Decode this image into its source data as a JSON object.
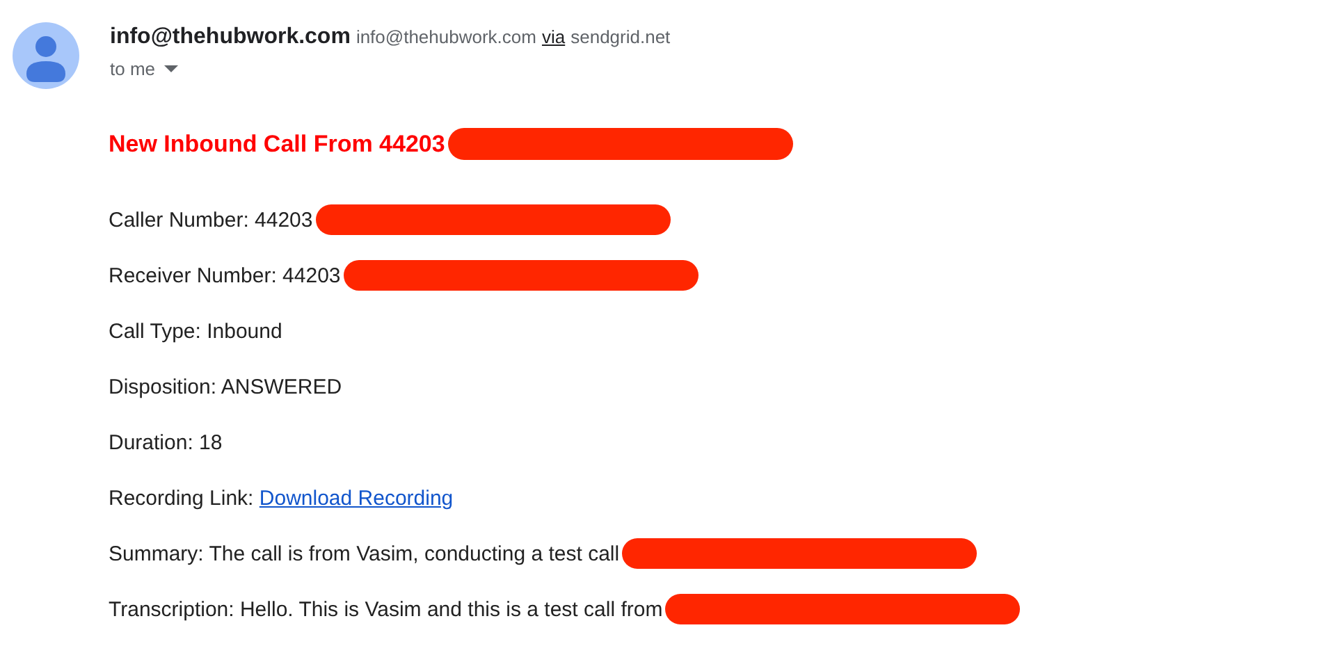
{
  "sender": {
    "name": "info@thehubwork.com",
    "email": "info@thehubwork.com",
    "via_label": "via",
    "via_domain": "sendgrid.net"
  },
  "recipient": "to me",
  "subject": {
    "text": "New Inbound Call From 44203",
    "redacted": true
  },
  "fields": [
    {
      "text": "Caller Number: 44203",
      "redacted": true
    },
    {
      "text": "Receiver Number: 44203",
      "redacted": true
    },
    {
      "text": "Call Type: Inbound",
      "redacted": false
    },
    {
      "text": "Disposition: ANSWERED",
      "redacted": false
    },
    {
      "text": "Duration: 18",
      "redacted": false
    },
    {
      "text": "Recording Link:",
      "link": "Download Recording",
      "redacted": false
    },
    {
      "text": "Summary: The call is from Vasim, conducting a test call",
      "redacted": true
    },
    {
      "text": "Transcription: Hello. This is Vasim and this is a test call from",
      "redacted": true
    }
  ]
}
